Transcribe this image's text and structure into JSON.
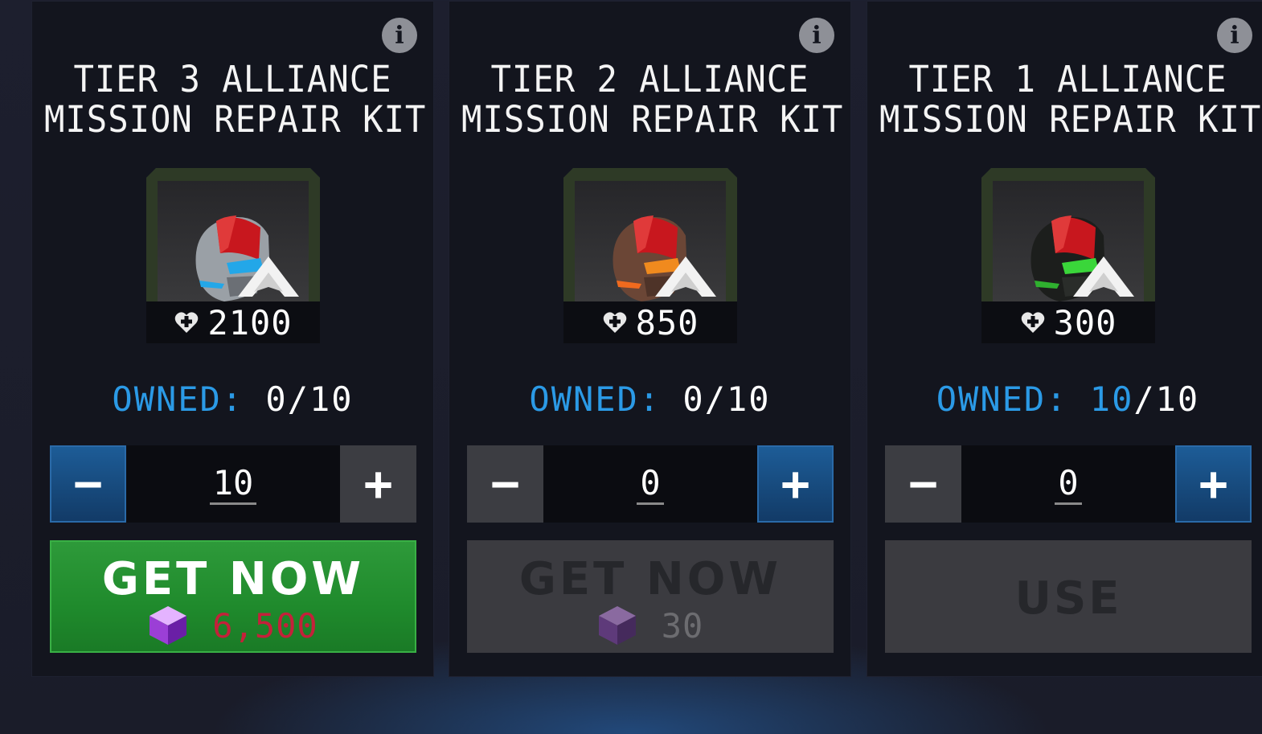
{
  "cards": [
    {
      "title_line1": "TIER 3 ALLIANCE",
      "title_line2": "MISSION REPAIR KIT",
      "heal_value": "2100",
      "owned_label": "OWNED:",
      "owned_current": "0",
      "owned_max": "/10",
      "quantity": "10",
      "action_label": "GET NOW",
      "price": "6,500",
      "helmet_color": "#8f949a",
      "visor_color": "#23a7e8"
    },
    {
      "title_line1": "TIER 2 ALLIANCE",
      "title_line2": "MISSION REPAIR KIT",
      "heal_value": "850",
      "owned_label": "OWNED:",
      "owned_current": "0",
      "owned_max": "/10",
      "quantity": "0",
      "action_label": "GET NOW",
      "price": "30",
      "helmet_color": "#6b4636",
      "visor_color": "#f08a1e"
    },
    {
      "title_line1": "TIER 1 ALLIANCE",
      "title_line2": "MISSION REPAIR KIT",
      "heal_value": "300",
      "owned_label": "OWNED:",
      "owned_current": "10",
      "owned_max": "/10",
      "quantity": "0",
      "action_label": "USE"
    }
  ],
  "icons": {
    "info": "info-icon",
    "heal": "heart-plus-icon",
    "currency": "purple-cube-icon",
    "alliance": "alliance-emblem-icon"
  },
  "stepper": {
    "minus": "−",
    "plus": "+"
  },
  "info_glyph": "i"
}
